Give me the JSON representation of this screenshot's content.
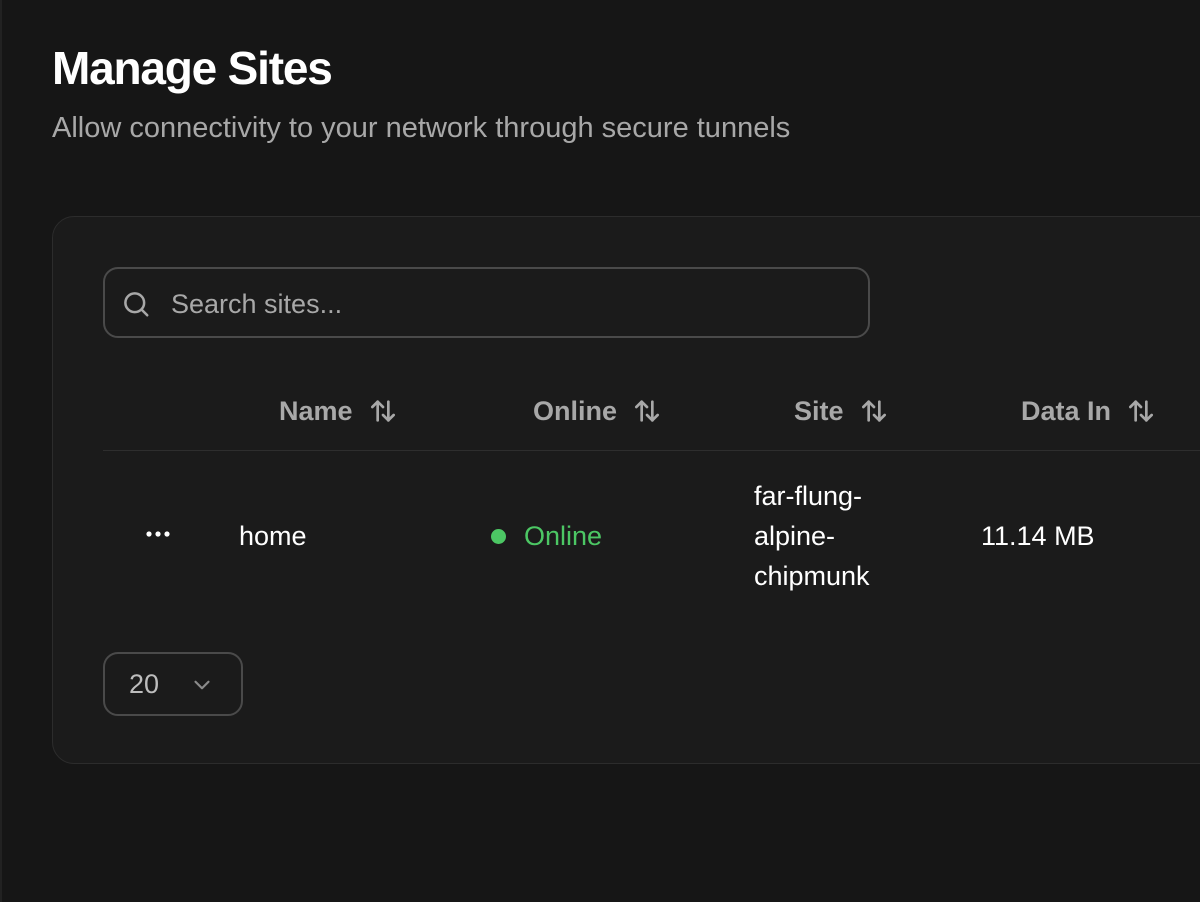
{
  "header": {
    "title": "Manage Sites",
    "subtitle": "Allow connectivity to your network through secure tunnels"
  },
  "search": {
    "placeholder": "Search sites...",
    "value": ""
  },
  "table": {
    "columns": [
      {
        "label": "Name",
        "sortable": true
      },
      {
        "label": "Online",
        "sortable": true
      },
      {
        "label": "Site",
        "sortable": true
      },
      {
        "label": "Data In",
        "sortable": true
      }
    ],
    "rows": [
      {
        "name": "home",
        "status": "Online",
        "site": "far-flung-alpine-chipmunk",
        "site_lines": [
          "far-flung-",
          "alpine-",
          "chipmunk"
        ],
        "data_in": "11.14 MB"
      }
    ]
  },
  "pagination": {
    "page_size": "20"
  },
  "icons": {
    "search": "search-icon",
    "sort": "sort-arrows-icon",
    "row_menu": "more-horizontal-icon",
    "page_size_toggle": "chevron-down-icon"
  },
  "colors": {
    "background": "#161616",
    "card": "#1b1b1b",
    "online": "#4cc764",
    "muted_text": "#a8a8a8"
  }
}
